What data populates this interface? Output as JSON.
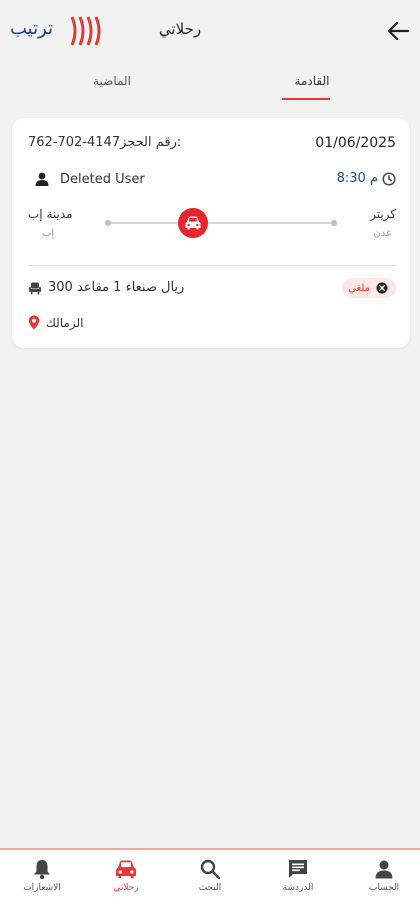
{
  "header": {
    "title": "رحلاتي",
    "logo_text": "ترتيب"
  },
  "tabs": {
    "upcoming": "القادمة",
    "past": "الماضية"
  },
  "trip": {
    "date": "01/06/2025",
    "booking_number": "762-702-4147رقم الحجز:",
    "time": "م 8:30",
    "user": "Deleted User",
    "from_city": "كريتر",
    "from_sub": "عدن",
    "to_city": "مدينة إب",
    "to_sub": "إب",
    "status": "ملغي",
    "price_seats": "300 ريال صنعاء 1 مقاعد",
    "location": "الزمالك"
  },
  "nav": {
    "items": [
      {
        "label": "الحساب",
        "icon": "person-icon"
      },
      {
        "label": "الدردشة",
        "icon": "chat-icon"
      },
      {
        "label": "البحث",
        "icon": "search-icon"
      },
      {
        "label": "رحلاتي",
        "icon": "car-icon"
      },
      {
        "label": "الاشعارات",
        "icon": "bell-icon"
      }
    ],
    "active_index": 3
  },
  "colors": {
    "accent": "#e53935",
    "brand_blue": "#1d3d8f",
    "background": "#f2f2f3",
    "time_color": "#1f4f7a"
  }
}
